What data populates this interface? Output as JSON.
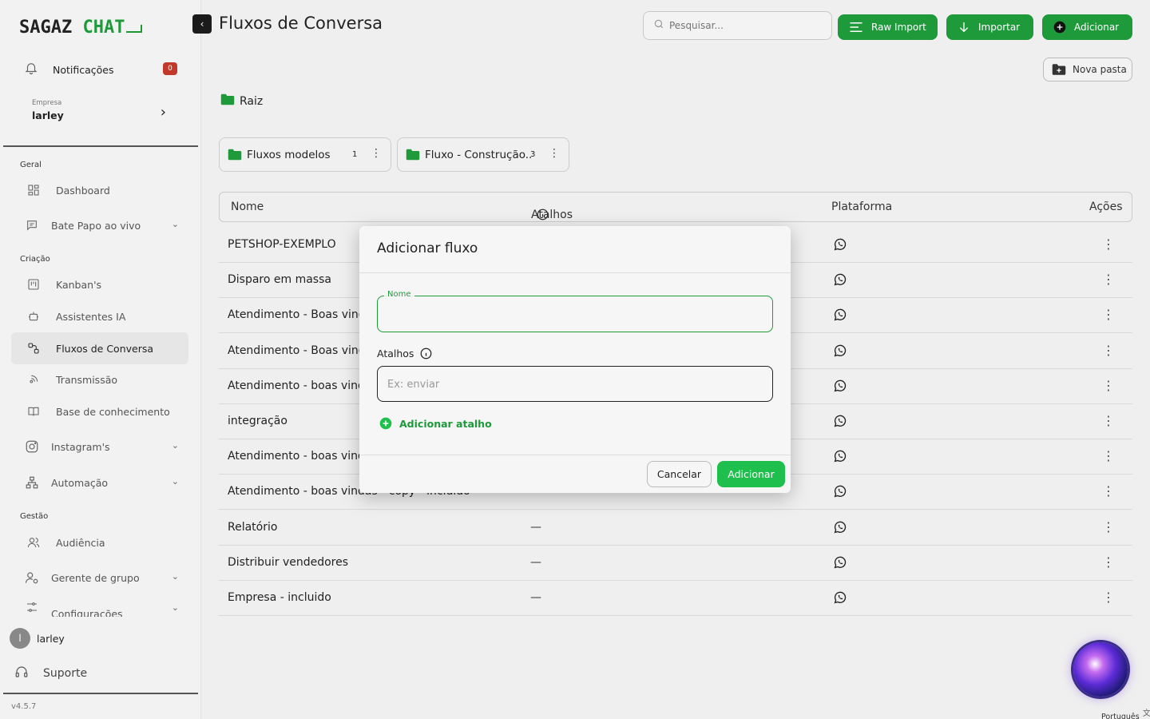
{
  "brand": {
    "name_dark": "SAGAZ",
    "name_green": "CHAT"
  },
  "sidebar": {
    "notifications": {
      "label": "Notificações",
      "count": "0"
    },
    "company": {
      "caption": "Empresa",
      "name": "larley"
    },
    "sections": {
      "geral": "Geral",
      "criacao": "Criação",
      "gestao": "Gestão"
    },
    "items": {
      "dashboard": "Dashboard",
      "bate_papo": "Bate Papo ao vivo",
      "kanbans": "Kanban's",
      "assistentes": "Assistentes IA",
      "fluxos": "Fluxos de Conversa",
      "transmissao": "Transmissão",
      "base": "Base de conhecimento",
      "instagram": "Instagram's",
      "automacao": "Automação",
      "audiencia": "Audiência",
      "gerente": "Gerente de grupo",
      "configuracoes": "Configurações"
    },
    "user": {
      "initial": "l",
      "name": "larley"
    },
    "support": "Suporte",
    "version": "v4.5.7"
  },
  "header": {
    "title": "Fluxos de Conversa",
    "search_placeholder": "Pesquisar...",
    "raw_import": "Raw Import",
    "importar": "Importar",
    "adicionar": "Adicionar",
    "nova_pasta": "Nova pasta"
  },
  "breadcrumb": {
    "root": "Raiz"
  },
  "folders": [
    {
      "name": "Fluxos modelos",
      "count": "1"
    },
    {
      "name": "Fluxo - Construção..",
      "count": "3"
    }
  ],
  "table": {
    "columns": {
      "nome": "Nome",
      "atalhos": "Atalhos",
      "plataforma": "Plataforma",
      "acoes": "Ações"
    },
    "rows": [
      {
        "name": "PETSHOP-EXEMPLO",
        "atalhos": ""
      },
      {
        "name": "Disparo em massa",
        "atalhos": ""
      },
      {
        "name": "Atendimento - Boas vinda",
        "atalhos": ""
      },
      {
        "name": "Atendimento - Boas vinda",
        "atalhos": ""
      },
      {
        "name": "Atendimento - boas vinda",
        "atalhos": ""
      },
      {
        "name": "integração",
        "atalhos": ""
      },
      {
        "name": "Atendimento - boas vinda",
        "atalhos": ""
      },
      {
        "name": "Atendimento - boas vindas - copy - incluido",
        "atalhos": ""
      },
      {
        "name": "Relatório",
        "atalhos": "—"
      },
      {
        "name": "Distribuir vendedores",
        "atalhos": "—"
      },
      {
        "name": "Empresa - incluido",
        "atalhos": "—"
      }
    ]
  },
  "modal": {
    "title": "Adicionar fluxo",
    "nome_label": "Nome",
    "nome_value": "",
    "atalhos_label": "Atalhos",
    "atalhos_placeholder": "Ex: enviar",
    "add_atalho": "Adicionar atalho",
    "cancel": "Cancelar",
    "submit": "Adicionar"
  },
  "footer": {
    "language": "Português"
  },
  "colors": {
    "accent": "#1e9a3a",
    "accent_bright": "#1fbf4d",
    "badge": "#c0392b"
  }
}
